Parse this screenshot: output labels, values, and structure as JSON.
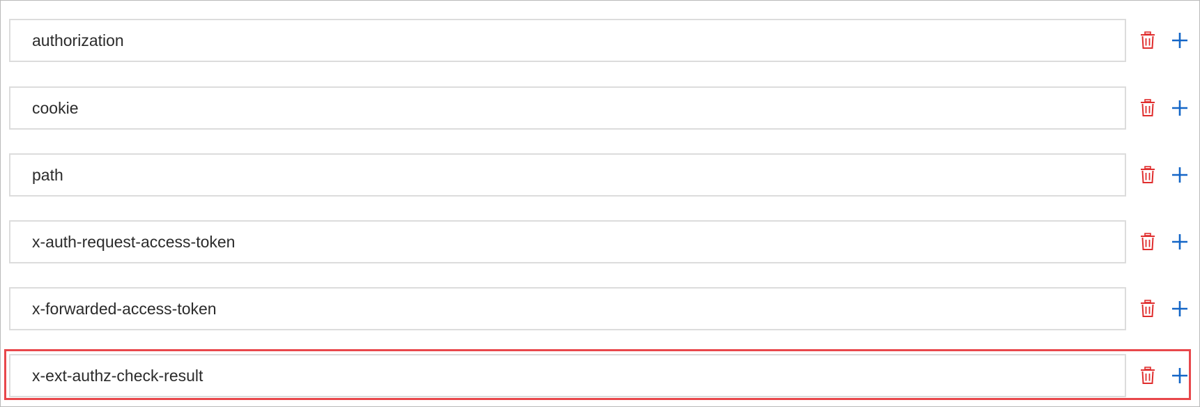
{
  "fields": [
    {
      "value": "authorization"
    },
    {
      "value": "cookie"
    },
    {
      "value": "path"
    },
    {
      "value": "x-auth-request-access-token"
    },
    {
      "value": "x-forwarded-access-token"
    },
    {
      "value": "x-ext-authz-check-result"
    }
  ],
  "icons": {
    "delete": "trash-icon",
    "add": "plus-icon"
  },
  "colors": {
    "delete_icon": "#e02d2d",
    "add_icon": "#1466c7",
    "highlight_border": "#e8474b",
    "field_border": "#dcdcdc"
  }
}
